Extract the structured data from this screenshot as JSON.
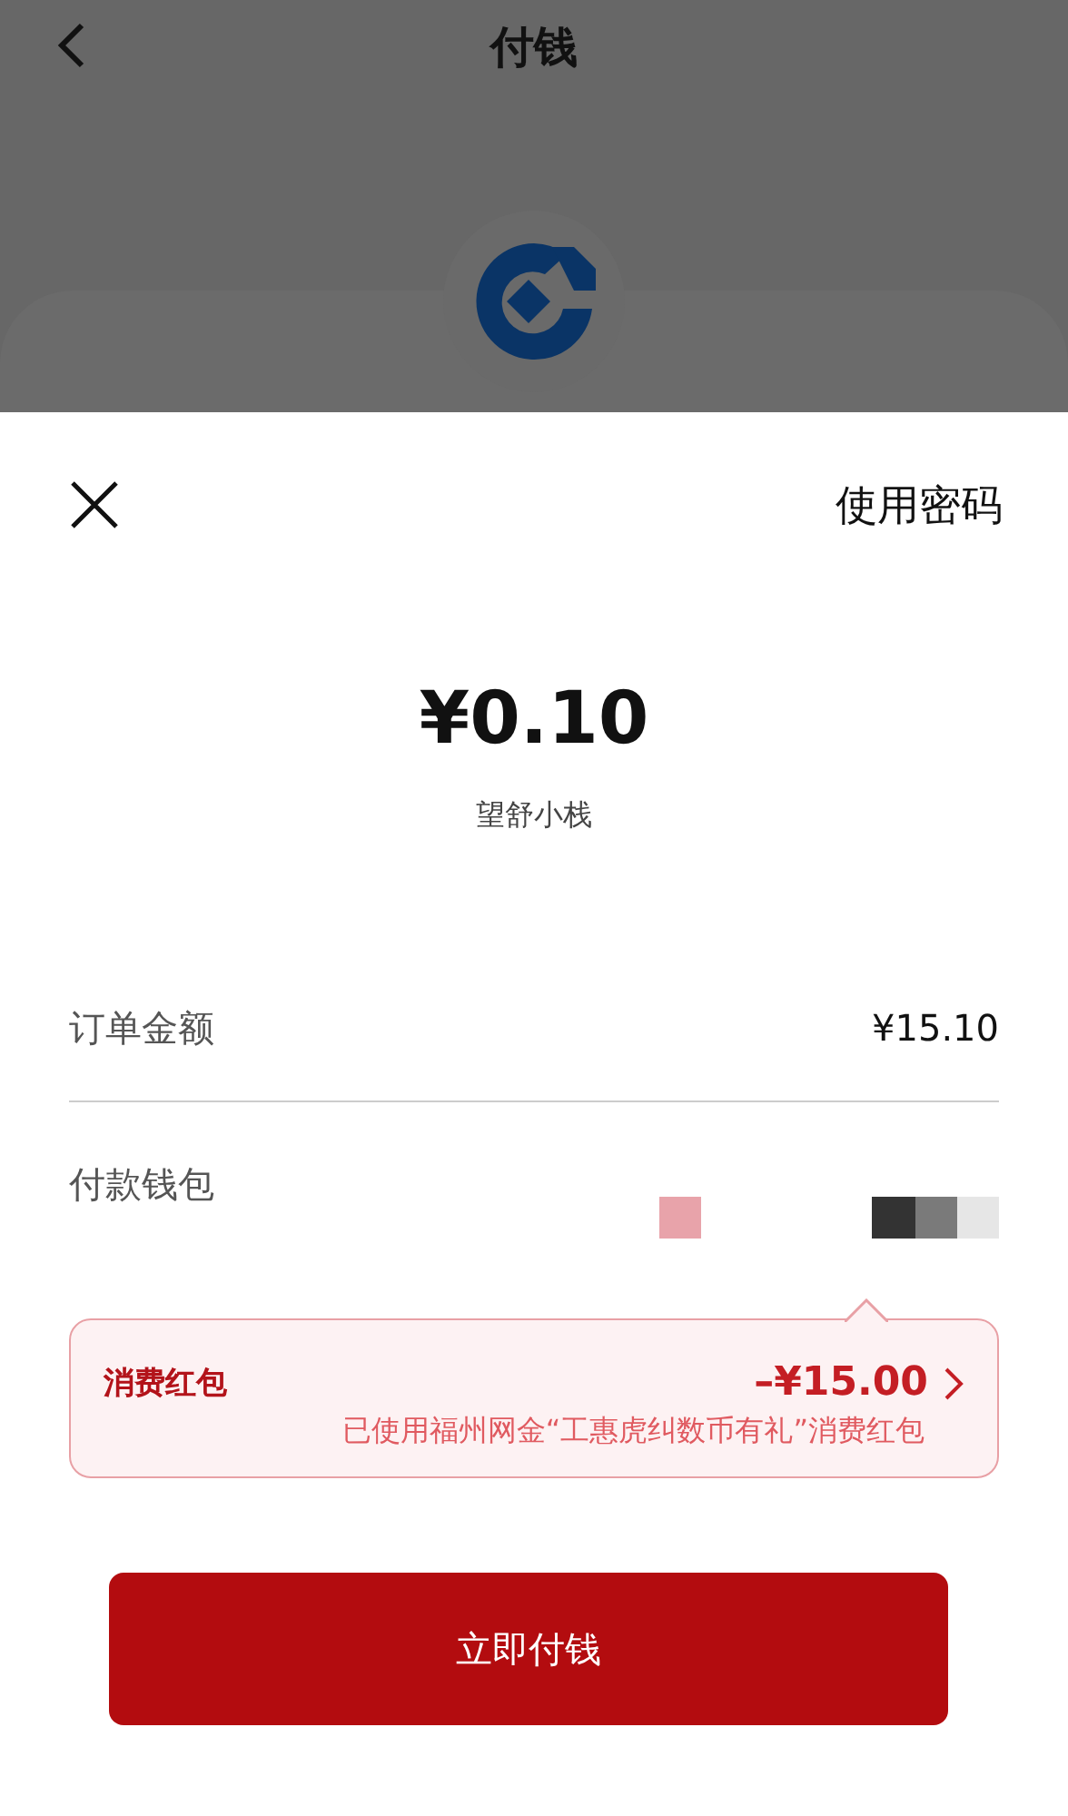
{
  "header": {
    "title": "付钱"
  },
  "sheet": {
    "use_password": "使用密码",
    "amount": "¥0.10",
    "merchant": "望舒小栈",
    "rows": [
      {
        "kind": "value",
        "label": "订单金额",
        "value": "¥15.10"
      },
      {
        "kind": "wallet",
        "label": "付款钱包"
      }
    ],
    "red_packet": {
      "label": "消费红包",
      "amount": "–¥15.00",
      "note": "已使用福州网金“工惠虎纠数币有礼”消费红包"
    },
    "pay_button": "立即付钱"
  }
}
